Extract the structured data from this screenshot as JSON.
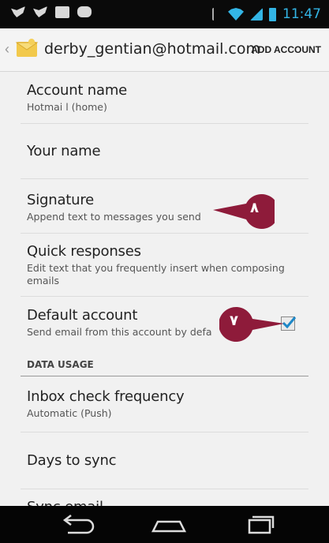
{
  "status_bar": {
    "time": "11:47",
    "left_icons": [
      "twitter-icon",
      "twitter-icon",
      "gallery-icon",
      "messages-icon"
    ],
    "right_icons": [
      "bluetooth-icon",
      "wifi-icon",
      "signal-icon",
      "battery-icon"
    ]
  },
  "action_bar": {
    "account_email": "derby_gentian@hotmail.com",
    "add_account_label": "ADD ACCOUNT"
  },
  "settings": {
    "account_name": {
      "title": "Account name",
      "summary": "Hotmai l (home)"
    },
    "your_name": {
      "title": "Your name"
    },
    "signature": {
      "title": "Signature",
      "summary": "Append text to messages you send"
    },
    "quick_responses": {
      "title": "Quick responses",
      "summary": "Edit text that you frequently insert when composing emails"
    },
    "default_account": {
      "title": "Default account",
      "summary": "Send email from this account by defa",
      "checked": true
    },
    "data_usage_header": "DATA USAGE",
    "inbox_check": {
      "title": "Inbox check frequency",
      "summary": "Automatic (Push)"
    },
    "days_to_sync": {
      "title": "Days to sync"
    },
    "sync_email": {
      "title": "Sync email"
    }
  },
  "callouts": [
    {
      "number": "٨",
      "target": "signature"
    },
    {
      "number": "٧",
      "target": "default_account"
    }
  ],
  "colors": {
    "accent": "#33b5e5",
    "callout": "#8e1b3a",
    "checkbox_check": "#1e88c8"
  }
}
